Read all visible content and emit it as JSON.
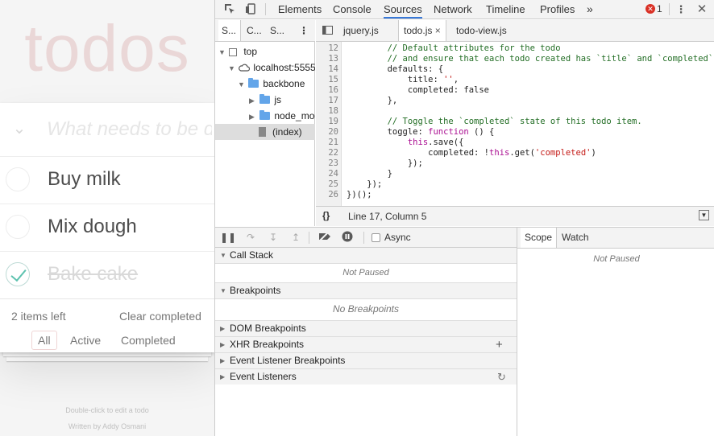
{
  "todo": {
    "title": "todos",
    "new_placeholder": "What needs to be done?",
    "toggle_all_icon": "chevron-down-icon",
    "items": [
      {
        "label": "Buy milk",
        "completed": false
      },
      {
        "label": "Mix dough",
        "completed": false
      },
      {
        "label": "Bake cake",
        "completed": true
      }
    ],
    "count": "2 items left",
    "clear_completed": "Clear completed",
    "filters": [
      "All",
      "Active",
      "Completed"
    ],
    "selected_filter": "All",
    "info_line1": "Double-click to edit a todo",
    "info_line2": "Written by Addy Osmani"
  },
  "devtools": {
    "tabs": [
      "Elements",
      "Console",
      "Sources",
      "Network",
      "Timeline",
      "Profiles"
    ],
    "active_tab": "Sources",
    "more_tabs": "»",
    "error_count": "1",
    "error_icon_label": "✕",
    "navigator": {
      "tabs": [
        "S...",
        "C...",
        "S..."
      ],
      "tree": [
        {
          "label": "top"
        },
        {
          "label": "localhost:5555"
        },
        {
          "label": "backbone"
        },
        {
          "label": "js"
        },
        {
          "label": "node_modules"
        },
        {
          "label": "(index)"
        }
      ]
    },
    "editor": {
      "files": [
        "jquery.js",
        "todo.js",
        "todo-view.js"
      ],
      "active_file": "todo.js",
      "close_icon": "×",
      "lines": [
        {
          "n": "12",
          "text": "        // Default attributes for the todo"
        },
        {
          "n": "13",
          "text": "        // and ensure that each todo created has `title` and `completed` keys."
        },
        {
          "n": "14",
          "text": "        defaults: {"
        },
        {
          "n": "15",
          "text": "            title: '',"
        },
        {
          "n": "16",
          "text": "            completed: false"
        },
        {
          "n": "17",
          "text": "        },"
        },
        {
          "n": "18",
          "text": ""
        },
        {
          "n": "19",
          "text": "        // Toggle the `completed` state of this todo item."
        },
        {
          "n": "20",
          "text": "        toggle: function () {"
        },
        {
          "n": "21",
          "text": "            this.save({"
        },
        {
          "n": "22",
          "text": "                completed: !this.get('completed')"
        },
        {
          "n": "23",
          "text": "            });"
        },
        {
          "n": "24",
          "text": "        }"
        },
        {
          "n": "25",
          "text": "    });"
        },
        {
          "n": "26",
          "text": "})();"
        }
      ],
      "status_brace": "{}",
      "cursor_position": "Line 17, Column 5"
    },
    "debugger": {
      "async_label": "Async",
      "sections": [
        {
          "title": "Call Stack",
          "expanded": true,
          "message": "Not Paused"
        },
        {
          "title": "Breakpoints",
          "expanded": true,
          "message": "No Breakpoints"
        },
        {
          "title": "DOM Breakpoints",
          "expanded": false
        },
        {
          "title": "XHR Breakpoints",
          "expanded": false
        },
        {
          "title": "Event Listener Breakpoints",
          "expanded": false
        },
        {
          "title": "Event Listeners",
          "expanded": false
        }
      ],
      "xhr_add_icon": "+",
      "refresh_icon": "↻"
    },
    "scope": {
      "tabs": [
        "Scope",
        "Watch"
      ],
      "active": "Scope",
      "message": "Not Paused"
    }
  }
}
